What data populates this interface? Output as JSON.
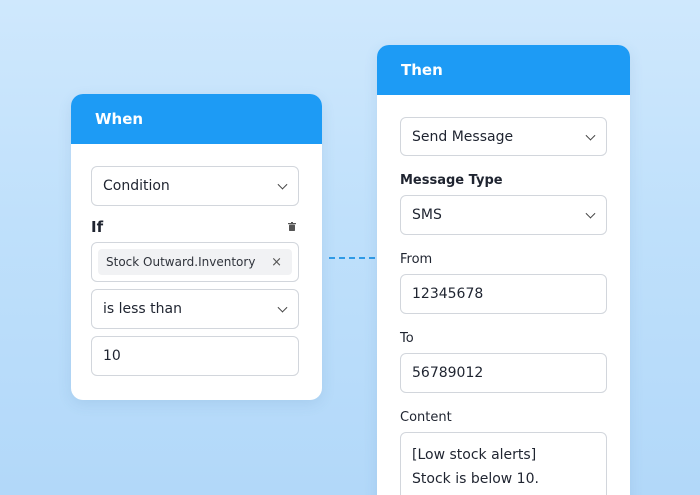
{
  "when": {
    "header": "When",
    "type_select": "Condition",
    "if_label": "If",
    "field_chip": "Stock Outward.Inventory",
    "chip_remove": "×",
    "operator_select": "is less than",
    "value": "10"
  },
  "then": {
    "header": "Then",
    "action_select": "Send Message",
    "message_type_label": "Message Type",
    "message_type_select": "SMS",
    "from_label": "From",
    "from_value": "12345678",
    "to_label": "To",
    "to_value": "56789012",
    "content_label": "Content",
    "content_value": "[Low stock alerts]\nStock is below 10."
  },
  "colors": {
    "header_blue": "#1d9bf5",
    "connector_blue": "#2f9ae6"
  },
  "icons": {
    "dropdown": "chevron-down-icon",
    "delete": "trash-icon",
    "remove_chip": "close-icon"
  }
}
